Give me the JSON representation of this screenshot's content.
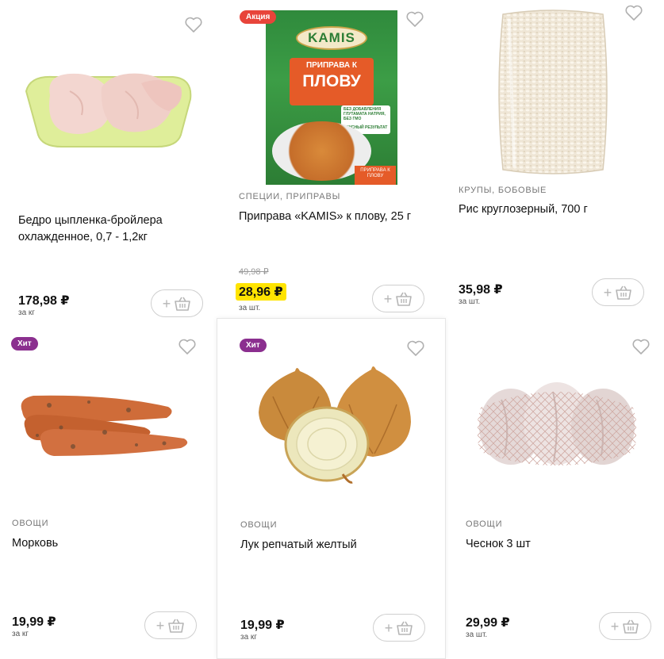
{
  "currency": "₽",
  "products": [
    {
      "category": "",
      "title": "Бедро цыпленка-бройлера охлажденное, 0,7 - 1,2кг",
      "price": "178,98 ₽",
      "old_price": "",
      "unit": "за кг",
      "badge": "",
      "image": "chicken-thighs-tray"
    },
    {
      "category": "СПЕЦИИ, ПРИПРАВЫ",
      "title": "Приправа «KAMIS» к плову, 25 г",
      "price": "28,96 ₽",
      "old_price": "49,98 ₽",
      "unit": "за шт.",
      "badge": "Акция",
      "image": "kamis-seasoning-pack",
      "pack": {
        "brand": "KAMIS",
        "line1": "ПРИПРАВА К",
        "line2": "ПЛОВУ",
        "note1": "БЕЗ ДОБАВЛЕНИЯ ГЛУТАМАТА НАТРИЯ, БЕЗ ГМО",
        "note2": "ВКУСНЫЙ РЕЗУЛЬТАТ",
        "corner": "ПРИПРАВА К ПЛОВУ"
      }
    },
    {
      "category": "КРУПЫ, БОБОВЫЕ",
      "title": "Рис круглозерный, 700 г",
      "price": "35,98 ₽",
      "old_price": "",
      "unit": "за шт.",
      "badge": "",
      "image": "rice-bag"
    },
    {
      "category": "ОВОЩИ",
      "title": "Морковь",
      "price": "19,99 ₽",
      "old_price": "",
      "unit": "за кг",
      "badge": "Хит",
      "image": "carrots"
    },
    {
      "category": "ОВОЩИ",
      "title": "Лук репчатый желтый",
      "price": "19,99 ₽",
      "old_price": "",
      "unit": "за кг",
      "badge": "Хит",
      "image": "onions"
    },
    {
      "category": "ОВОЩИ",
      "title": "Чеснок 3 шт",
      "price": "29,99 ₽",
      "old_price": "",
      "unit": "за шт.",
      "badge": "",
      "image": "garlic-net"
    }
  ],
  "cart_button": {
    "plus": "+",
    "icon": "basket-icon"
  },
  "favorite_icon": "heart-outline-icon",
  "colors": {
    "sale_badge": "#e8443a",
    "hit_badge": "#8b2f8f",
    "promo_price_bg": "#ffe400"
  }
}
